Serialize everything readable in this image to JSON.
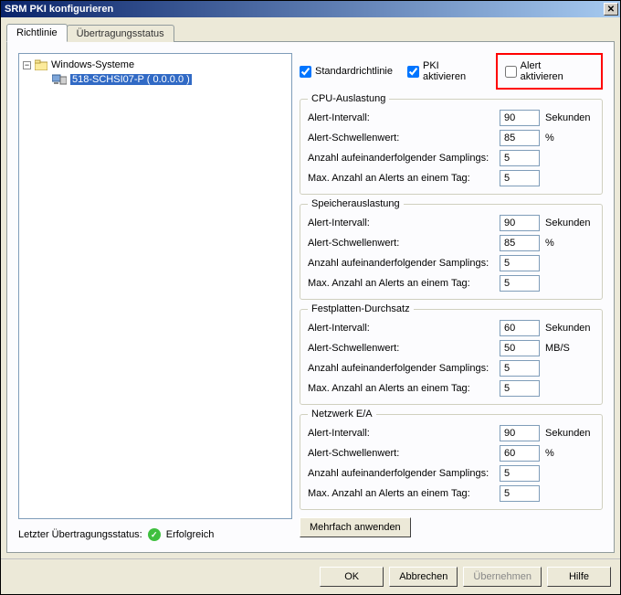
{
  "window": {
    "title": "SRM PKI konfigurieren"
  },
  "tabs": {
    "active": "Richtlinie",
    "inactive": "Übertragungsstatus"
  },
  "tree": {
    "root": "Windows-Systeme",
    "node": "518-SCHSI07-P ( 0.0.0.0 )"
  },
  "status": {
    "label": "Letzter Übertragungsstatus:",
    "value": "Erfolgreich"
  },
  "checks": {
    "standard": "Standardrichtlinie",
    "pki": "PKI aktivieren",
    "alert": "Alert aktivieren"
  },
  "labels": {
    "interval": "Alert-Intervall:",
    "threshold": "Alert-Schwellenwert:",
    "samplings": "Anzahl aufeinanderfolgender Samplings:",
    "maxday": "Max. Anzahl an Alerts an einem Tag:"
  },
  "units": {
    "seconds": "Sekunden",
    "percent": "%",
    "mbs": "MB/S"
  },
  "groups": {
    "cpu": {
      "legend": "CPU-Auslastung",
      "interval": "90",
      "threshold": "85",
      "samplings": "5",
      "maxday": "5"
    },
    "mem": {
      "legend": "Speicherauslastung",
      "interval": "90",
      "threshold": "85",
      "samplings": "5",
      "maxday": "5"
    },
    "disk": {
      "legend": "Festplatten-Durchsatz",
      "interval": "60",
      "threshold": "50",
      "samplings": "5",
      "maxday": "5"
    },
    "net": {
      "legend": "Netzwerk E/A",
      "interval": "90",
      "threshold": "60",
      "samplings": "5",
      "maxday": "5"
    }
  },
  "buttons": {
    "multi": "Mehrfach anwenden",
    "ok": "OK",
    "cancel": "Abbrechen",
    "apply": "Übernehmen",
    "help": "Hilfe"
  }
}
